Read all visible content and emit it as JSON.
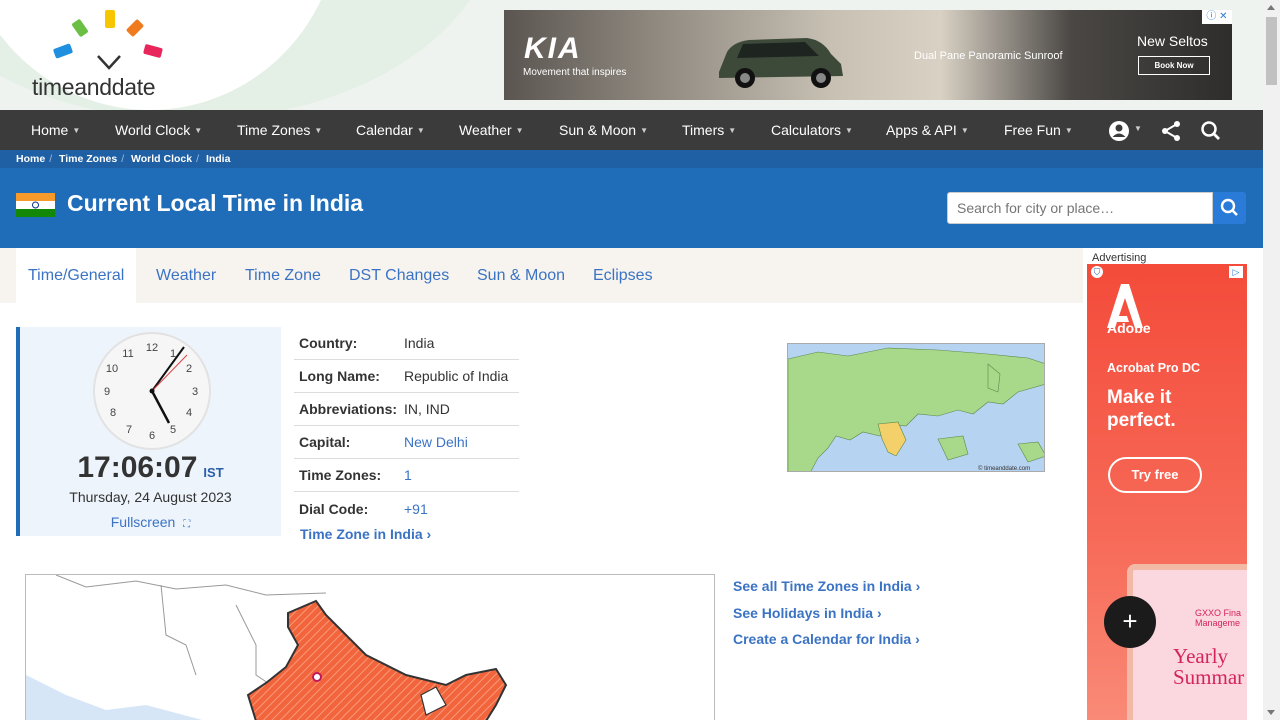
{
  "header": {
    "logo_text": "timeanddate",
    "ad": {
      "brand": "KIA",
      "tagline": "Movement that inspires",
      "feature": "Dual Pane Panoramic Sunroof",
      "model": "New Seltos",
      "cta": "Book Now",
      "close_icon": "close-icon"
    }
  },
  "nav": {
    "items": [
      {
        "label": "Home"
      },
      {
        "label": "World Clock"
      },
      {
        "label": "Time Zones"
      },
      {
        "label": "Calendar"
      },
      {
        "label": "Weather"
      },
      {
        "label": "Sun & Moon"
      },
      {
        "label": "Timers"
      },
      {
        "label": "Calculators"
      },
      {
        "label": "Apps & API"
      },
      {
        "label": "Free Fun"
      }
    ],
    "icons": [
      "account-icon",
      "share-icon",
      "search-icon"
    ]
  },
  "breadcrumb": [
    "Home",
    "Time Zones",
    "World Clock",
    "India"
  ],
  "hero": {
    "title": "Current Local Time in India",
    "search_placeholder": "Search for city or place…"
  },
  "tabs": [
    "Time/General",
    "Weather",
    "Time Zone",
    "DST Changes",
    "Sun & Moon",
    "Eclipses"
  ],
  "clock": {
    "time": "17:06:07",
    "tz": "IST",
    "date": "Thursday, 24 August 2023",
    "fullscreen": "Fullscreen",
    "numbers": [
      "12",
      "1",
      "2",
      "3",
      "4",
      "5",
      "6",
      "7",
      "8",
      "9",
      "10",
      "11"
    ]
  },
  "info": {
    "rows": [
      {
        "key": "Country:",
        "value": "India"
      },
      {
        "key": "Long Name:",
        "value": "Republic of India"
      },
      {
        "key": "Abbreviations:",
        "value": "IN, IND"
      },
      {
        "key": "Capital:",
        "value": "New Delhi"
      },
      {
        "key": "Time Zones:",
        "value": "1"
      },
      {
        "key": "Dial Code:",
        "value": "+91"
      }
    ],
    "tz_link": "Time Zone in India"
  },
  "world_map": {
    "credit": "© timeanddate.com"
  },
  "side_links": [
    "See all Time Zones in India",
    "See Holidays in India",
    "Create a Calendar for India"
  ],
  "right_ad": {
    "label": "Advertising",
    "brand": "Adobe",
    "product": "Acrobat Pro DC",
    "headline": "Make it perfect.",
    "cta": "Try free",
    "card_brand": "GXXO Fina Manageme",
    "card_title": "Yearly Summar"
  },
  "colors": {
    "nav_bg": "#3b3b3b",
    "hero_bg": "#1f6db9",
    "breadcrumb_bg": "#1f5fa3",
    "link": "#3b73c4",
    "ad_red": "#f44b3a",
    "india_highlight": "#f2653c"
  }
}
